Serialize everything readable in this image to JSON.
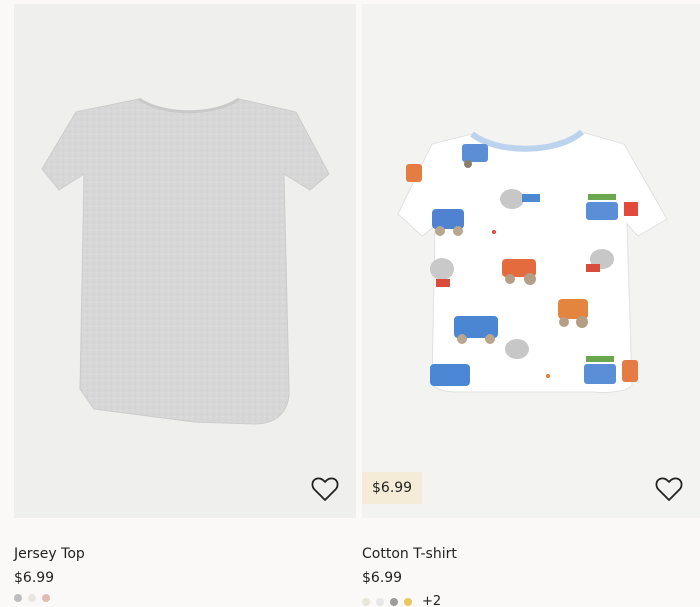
{
  "products": [
    {
      "name": "Jersey Top",
      "price": "$6.99",
      "swatches": [
        "#bdbdbd",
        "#e9e6e0",
        "#e4b9b5"
      ]
    },
    {
      "name": "Cotton T-shirt",
      "price": "$6.99",
      "badge_price": "$6.99",
      "swatches": [
        "#e9e6da",
        "#e7e7e7",
        "#9c9c9c",
        "#e8c85a"
      ],
      "more_colors": "+2"
    }
  ],
  "colors": {
    "badge_bg": "#f4ecd6",
    "image_bg": "#efefed",
    "text": "#222222"
  },
  "icons": {
    "favorite": "heart-outline-icon"
  }
}
